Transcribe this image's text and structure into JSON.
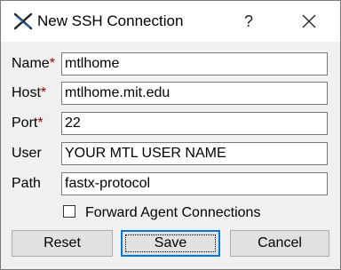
{
  "titlebar": {
    "title": "New SSH Connection",
    "app_icon": "fastx-x-logo-icon",
    "help_label": "?",
    "close_icon": "close-icon"
  },
  "form": {
    "required_marker": "*",
    "name": {
      "label": "Name",
      "required": true,
      "value": "mtlhome"
    },
    "host": {
      "label": "Host",
      "required": true,
      "value": "mtlhome.mit.edu"
    },
    "port": {
      "label": "Port",
      "required": true,
      "value": "22"
    },
    "user": {
      "label": "User",
      "required": false,
      "value": "YOUR MTL USER NAME"
    },
    "path": {
      "label": "Path",
      "required": false,
      "value": "fastx-protocol"
    },
    "forward_agent": {
      "label": "Forward Agent Connections",
      "checked": false
    }
  },
  "buttons": {
    "reset": "Reset",
    "save": "Save",
    "cancel": "Cancel"
  },
  "colors": {
    "required_marker": "#a00000",
    "default_button_border": "#0078d7",
    "titlebar_bg": "#ffffff",
    "dialog_bg": "#f0f0f0"
  }
}
